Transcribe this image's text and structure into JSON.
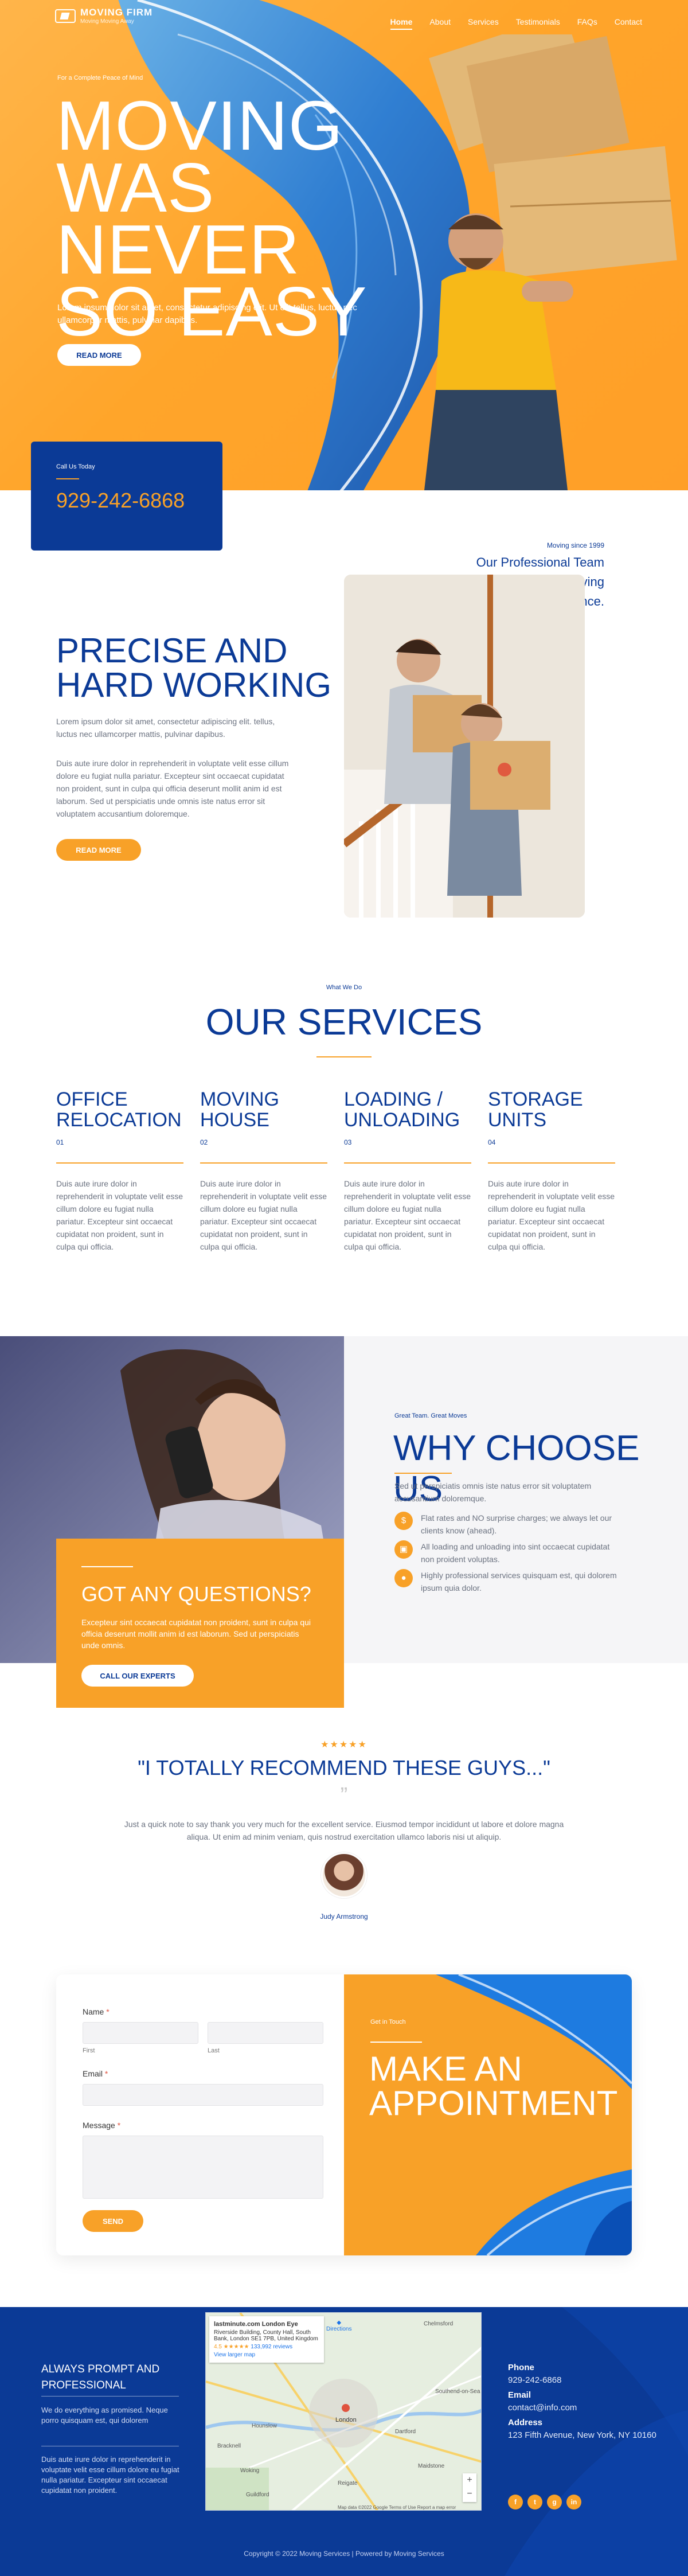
{
  "brand": {
    "name": "MOVING FIRM",
    "tagline": "Moving Moving Away"
  },
  "nav": [
    "Home",
    "About",
    "Services",
    "Testimonials",
    "FAQs",
    "Contact"
  ],
  "hero": {
    "kicker": "For a Complete Peace of Mind",
    "title_lines": [
      "MOVING",
      "WAS NEVER",
      "SO EASY"
    ],
    "text": "Lorem ipsum dolor sit amet, consectetur adipiscing elit. Ut elit tellus, luctus nec ullamcorper mattis, pulvinar dapibus.",
    "button": "READ MORE",
    "call_label": "Call Us Today",
    "phone": "929-242-6868"
  },
  "precise": {
    "since": "Moving since 1999",
    "team_text": "Our Professional Team Makes Packing and Moving a Nice Experience.",
    "title_lines": [
      "PRECISE AND",
      "HARD WORKING"
    ],
    "p1": "Lorem ipsum dolor sit amet, consectetur adipiscing elit. tellus, luctus nec ullamcorper mattis, pulvinar dapibus.",
    "p2": "Duis aute irure dolor in reprehenderit in voluptate velit esse cillum dolore eu fugiat nulla pariatur. Excepteur sint occaecat cupidatat non proident, sunt in culpa qui officia deserunt mollit anim id est laborum. Sed ut perspiciatis unde omnis iste natus error sit voluptatem accusantium doloremque.",
    "button": "READ MORE"
  },
  "services": {
    "kicker": "What We Do",
    "title": "OUR SERVICES",
    "items": [
      {
        "title": "OFFICE RELOCATION",
        "num": "01",
        "text": "Duis aute irure dolor in reprehenderit in voluptate velit esse cillum dolore eu fugiat nulla pariatur. Excepteur sint occaecat cupidatat non proident, sunt in culpa qui officia."
      },
      {
        "title": "MOVING HOUSE",
        "num": "02",
        "text": "Duis aute irure dolor in reprehenderit in voluptate velit esse cillum dolore eu fugiat nulla pariatur. Excepteur sint occaecat cupidatat non proident, sunt in culpa qui officia."
      },
      {
        "title": "LOADING / UNLOADING",
        "num": "03",
        "text": "Duis aute irure dolor in reprehenderit in voluptate velit esse cillum dolore eu fugiat nulla pariatur. Excepteur sint occaecat cupidatat non proident, sunt in culpa qui officia."
      },
      {
        "title": "STORAGE UNITS",
        "num": "04",
        "text": "Duis aute irure dolor in reprehenderit in voluptate velit esse cillum dolore eu fugiat nulla pariatur. Excepteur sint occaecat cupidatat non proident, sunt in culpa qui officia."
      }
    ]
  },
  "questions": {
    "title": "GOT ANY QUESTIONS?",
    "text": "Excepteur sint occaecat cupidatat non proident, sunt in culpa qui officia deserunt mollit anim id est laborum. Sed ut perspiciatis unde omnis.",
    "button": "CALL OUR EXPERTS"
  },
  "why": {
    "kicker": "Great Team. Great Moves",
    "title": "WHY CHOOSE US",
    "intro": "Sed ut perspiciatis omnis iste natus error sit voluptatem accusantium doloremque.",
    "features": [
      "Flat rates and NO surprise charges; we always let our clients know (ahead).",
      "All loading and unloading into sint occaecat cupidatat non proident voluptas.",
      "Highly professional services quisquam est, qui dolorem ipsum quia dolor."
    ]
  },
  "testimonial": {
    "stars": "★★★★★",
    "title": "\"I TOTALLY RECOMMEND THESE GUYS...\"",
    "quote_mark": "”",
    "text": "Just a quick note to say thank you very much for the excellent service. Eiusmod tempor incididunt ut labore et dolore magna aliqua. Ut enim ad minim veniam, quis nostrud exercitation ullamco laboris nisi ut aliquip.",
    "name": "Judy Armstrong"
  },
  "form": {
    "name_label": "Name",
    "first": "First",
    "last": "Last",
    "email_label": "Email",
    "message_label": "Message",
    "required": "*",
    "send": "SEND"
  },
  "appointment": {
    "kicker": "Get in Touch",
    "title_lines": [
      "MAKE AN",
      "APPOINTMENT"
    ]
  },
  "footer": {
    "heading_lines": [
      "ALWAYS PROMPT AND",
      "PROFESSIONAL"
    ],
    "p1": "We do everything as promised. Neque porro quisquam est, qui dolorem",
    "p2": "Duis aute irure dolor in reprehenderit in voluptate velit esse cillum dolore eu fugiat nulla pariatur. Excepteur sint occaecat cupidatat non proident.",
    "map": {
      "place": "lastminute.com London Eye",
      "address": "Riverside Building, County Hall, South Bank, London SE1 7PB, United Kingdom",
      "rating": "4.5 ★★★★★",
      "reviews": "133,992 reviews",
      "link": "View larger map",
      "directions": "Directions",
      "labels": [
        "Chelmsford",
        "Southend-on-Sea",
        "Hounslow",
        "Dartford",
        "Bracknell",
        "Woking",
        "Guildford",
        "Maidstone",
        "Reigate",
        "London"
      ],
      "attribution": "Map data ©2022 Google  Terms of Use  Report a map error"
    },
    "contact": {
      "phone_label": "Phone",
      "phone": "929-242-6868",
      "email_label": "Email",
      "email": "contact@info.com",
      "address_label": "Address",
      "address": "123 Fifth Avenue, New York, NY 10160"
    },
    "socials": [
      "f",
      "t",
      "g",
      "in"
    ],
    "copyright": "Copyright © 2022 Moving Services | Powered by Moving Services"
  },
  "colors": {
    "orange": "#f8a128",
    "navy": "#0b3a96",
    "blue_accent": "#1e7be0"
  }
}
